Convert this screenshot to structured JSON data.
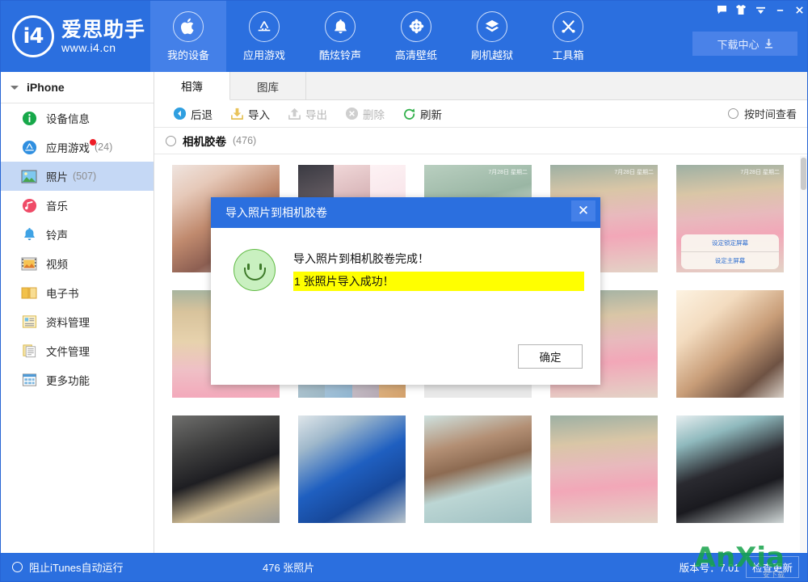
{
  "app": {
    "brand_name": "爱思助手",
    "brand_url": "www.i4.cn",
    "logo_text": "i4"
  },
  "header": {
    "nav": [
      {
        "label": "我的设备",
        "icon": "apple-icon",
        "active": true
      },
      {
        "label": "应用游戏",
        "icon": "appstore-icon",
        "active": false
      },
      {
        "label": "酷炫铃声",
        "icon": "bell-icon",
        "active": false
      },
      {
        "label": "高清壁纸",
        "icon": "flower-icon",
        "active": false
      },
      {
        "label": "刷机越狱",
        "icon": "box-icon",
        "active": false
      },
      {
        "label": "工具箱",
        "icon": "tools-icon",
        "active": false
      }
    ],
    "window_buttons": [
      {
        "name": "message-icon",
        "glyph": "▬"
      },
      {
        "name": "skin-icon",
        "glyph": "👕"
      },
      {
        "name": "menu-icon",
        "glyph": "▾"
      },
      {
        "name": "minimize-icon",
        "glyph": "–"
      },
      {
        "name": "close-icon",
        "glyph": "✕"
      }
    ],
    "download_center_label": "下载中心",
    "accent_color": "#2b6fdf",
    "accent_active_color": "#4480e8"
  },
  "sidebar": {
    "device_name": "iPhone",
    "items": [
      {
        "label": "设备信息",
        "count": "",
        "icon": "info-icon",
        "selected": false,
        "badge": false
      },
      {
        "label": "应用游戏",
        "count": "(24)",
        "icon": "appstore-icon",
        "selected": false,
        "badge": true
      },
      {
        "label": "照片",
        "count": "(507)",
        "icon": "photo-icon",
        "selected": true,
        "badge": false
      },
      {
        "label": "音乐",
        "count": "",
        "icon": "music-icon",
        "selected": false,
        "badge": false
      },
      {
        "label": "铃声",
        "count": "",
        "icon": "bell-icon",
        "selected": false,
        "badge": false
      },
      {
        "label": "视频",
        "count": "",
        "icon": "video-icon",
        "selected": false,
        "badge": false
      },
      {
        "label": "电子书",
        "count": "",
        "icon": "book-icon",
        "selected": false,
        "badge": false
      },
      {
        "label": "资料管理",
        "count": "",
        "icon": "data-icon",
        "selected": false,
        "badge": false
      },
      {
        "label": "文件管理",
        "count": "",
        "icon": "file-icon",
        "selected": false,
        "badge": false
      },
      {
        "label": "更多功能",
        "count": "",
        "icon": "more-icon",
        "selected": false,
        "badge": false
      }
    ]
  },
  "main": {
    "tabs": [
      {
        "label": "相簿",
        "active": true
      },
      {
        "label": "图库",
        "active": false
      }
    ],
    "toolbar": [
      {
        "label": "后退",
        "icon": "back-icon",
        "disabled": false
      },
      {
        "label": "导入",
        "icon": "import-icon",
        "disabled": false
      },
      {
        "label": "导出",
        "icon": "export-icon",
        "disabled": true
      },
      {
        "label": "删除",
        "icon": "delete-icon",
        "disabled": true
      },
      {
        "label": "刷新",
        "icon": "refresh-icon",
        "disabled": false
      }
    ],
    "view_by_time_label": "按时间查看",
    "album_name": "相机胶卷",
    "album_count": "(476)",
    "photos": [
      {
        "kind": "portrait-warm",
        "datestamp": "",
        "sheet": []
      },
      {
        "kind": "collage-light",
        "datestamp": "",
        "sheet": []
      },
      {
        "kind": "poster-pink",
        "datestamp": "7月28日 星期二",
        "sheet": []
      },
      {
        "kind": "beach-girl",
        "datestamp": "7月28日 星期二",
        "sheet": []
      },
      {
        "kind": "beach-girl",
        "datestamp": "7月28日 星期二",
        "sheet": [
          "设定锁定屏幕",
          "设定主屏幕"
        ]
      },
      {
        "kind": "beach-sand",
        "datestamp": "",
        "sheet": []
      },
      {
        "kind": "collage-grid",
        "datestamp": "",
        "sheet": []
      },
      {
        "kind": "ui-screenshot",
        "datestamp": "",
        "sheet": []
      },
      {
        "kind": "beach-girl",
        "datestamp": "",
        "sheet": []
      },
      {
        "kind": "sunset-girl",
        "datestamp": "",
        "sheet": []
      },
      {
        "kind": "street-man",
        "datestamp": "",
        "sheet": []
      },
      {
        "kind": "blue-jacket-man",
        "datestamp": "",
        "sheet": []
      },
      {
        "kind": "smiling-man",
        "datestamp": "",
        "sheet": []
      },
      {
        "kind": "beach-girl-arm",
        "datestamp": "",
        "sheet": []
      },
      {
        "kind": "dark-hair-girl",
        "datestamp": "",
        "sheet": []
      }
    ]
  },
  "modal": {
    "title": "导入照片到相机胶卷",
    "close_glyph": "✕",
    "message_line1": "导入照片到相机胶卷完成！",
    "message_line2": "1 张照片导入成功！",
    "highlight_color": "#ffff00",
    "ok_label": "确定",
    "icon": "smiley-face-icon"
  },
  "statusbar": {
    "itunes_label": "阻止iTunes自动运行",
    "photo_total": "476 张照片",
    "version_text": "版本号：7.01",
    "check_update_label": "检查更新",
    "watermark": "AnXia",
    "watermark_sub": "安下载"
  }
}
